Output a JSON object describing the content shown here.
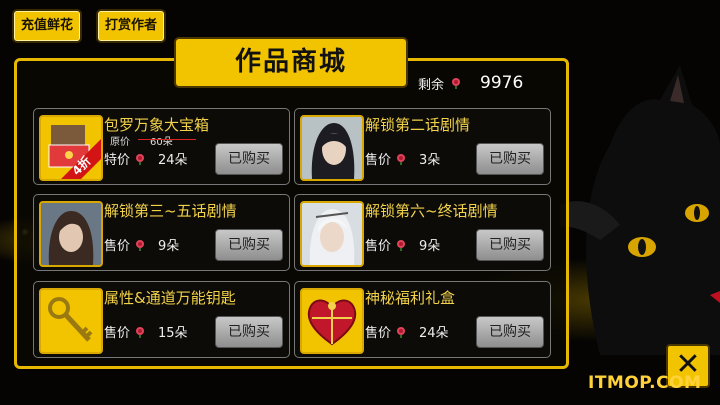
{
  "top_buttons": {
    "recharge": "充值鲜花",
    "tip": "打赏作者"
  },
  "title": "作品商城",
  "balance": {
    "label": "剩余",
    "value": "9976"
  },
  "items": [
    {
      "name": "包罗万象大宝箱",
      "original_label": "原价",
      "original_price": "60朵",
      "badge": "4折",
      "price_label": "特价",
      "price": "24朵",
      "button": "已购买",
      "icon": "treasure-box-icon"
    },
    {
      "name": "解锁第二话剧情",
      "price_label": "售价",
      "price": "3朵",
      "button": "已购买",
      "icon": "character-portrait-icon"
    },
    {
      "name": "解锁第三~五话剧情",
      "price_label": "售价",
      "price": "9朵",
      "button": "已购买",
      "icon": "character-portrait-icon"
    },
    {
      "name": "解锁第六~终话剧情",
      "price_label": "售价",
      "price": "9朵",
      "button": "已购买",
      "icon": "character-portrait-icon"
    },
    {
      "name": "属性&通道万能钥匙",
      "price_label": "售价",
      "price": "15朵",
      "button": "已购买",
      "icon": "golden-key-icon"
    },
    {
      "name": "神秘福利礼盒",
      "price_label": "售价",
      "price": "24朵",
      "button": "已购买",
      "icon": "heart-gift-box-icon"
    }
  ],
  "close": "✕",
  "watermark": "ITMOP.COM",
  "colors": {
    "accent": "#f2c400",
    "name_text": "#f2d24a"
  }
}
